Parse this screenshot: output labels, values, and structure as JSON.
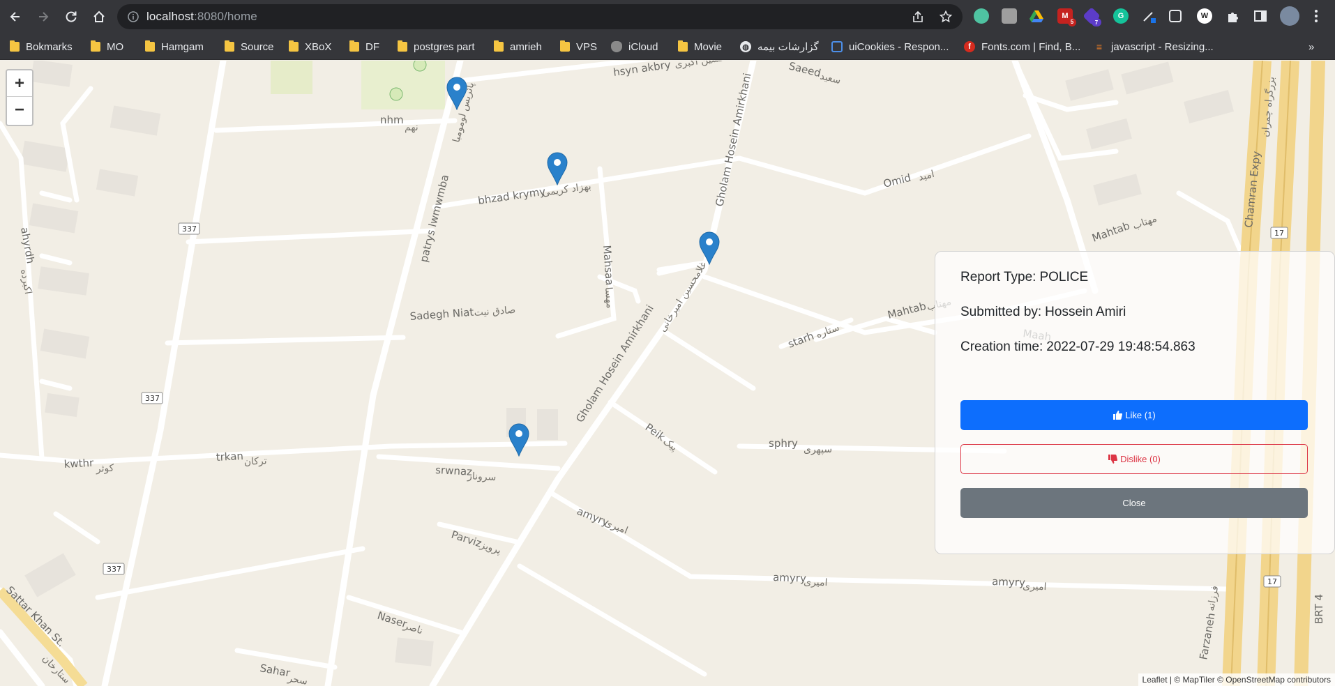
{
  "browser": {
    "url_host": "localhost",
    "url_path": ":8080/home"
  },
  "extensions": [
    {
      "icon": "lightbulb-extension-icon",
      "color": "#4fc3a1"
    },
    {
      "icon": "screenshot-extension-icon",
      "color": "#9e9e9e"
    },
    {
      "icon": "google-drive-icon",
      "color": "#34a853"
    },
    {
      "icon": "gmail-checker-icon",
      "color": "#c5221f",
      "badge": "5"
    },
    {
      "icon": "stack-extension-icon",
      "color": "#5c3cc8",
      "badge": "7"
    },
    {
      "icon": "grammarly-icon",
      "color": "#15c39a",
      "label": "G"
    },
    {
      "icon": "color-picker-icon",
      "color": "#3c3c3c"
    },
    {
      "icon": "cookie-extension-icon",
      "color": "#1f1f1f"
    },
    {
      "icon": "wordpress-icon",
      "color": "#1f1f1f",
      "label": "W"
    }
  ],
  "bookmarks": [
    {
      "label": "Bokmarks",
      "type": "folder"
    },
    {
      "label": "MO",
      "type": "folder"
    },
    {
      "label": "Hamgam",
      "type": "folder"
    },
    {
      "label": "Source",
      "type": "folder"
    },
    {
      "label": "XBoX",
      "type": "folder"
    },
    {
      "label": "DF",
      "type": "folder"
    },
    {
      "label": "postgres part",
      "type": "folder"
    },
    {
      "label": "amrieh",
      "type": "folder"
    },
    {
      "label": "VPS",
      "type": "folder"
    },
    {
      "label": "iCloud",
      "type": "apple"
    },
    {
      "label": "Movie",
      "type": "folder"
    },
    {
      "label": "گزارشات بیمه",
      "type": "globe"
    },
    {
      "label": "uiCookies - Respon...",
      "type": "uicookies"
    },
    {
      "label": "Fonts.com | Find, B...",
      "type": "fonts"
    },
    {
      "label": "javascript - Resizing...",
      "type": "stackoverflow"
    }
  ],
  "bookmarks_more": "»",
  "map": {
    "zoom_in": "+",
    "zoom_out": "−",
    "attribution": "Leaflet | © MapTiler © OpenStreetMap contributors",
    "labels": [
      "hsyn akbry",
      "حسین اکبری",
      "Saeed",
      "سعید",
      "nhm",
      "نهم",
      "bhzad krymy",
      "بهزاد کریمی",
      "Gholam Hosein Amirkhani",
      "Omid",
      "امید",
      "Mahtab",
      "مهتاب",
      "Chamran Expy",
      "بزرگراه چمران",
      "ahyrdh",
      "اکبرده",
      "patrys lwmwmba",
      "پاتریس لومومبا",
      "Mahsaa",
      "مهسا",
      "Sadegh Niat",
      "صادق نیت",
      "غلامحسین امیرخانی",
      "starh",
      "ستاره",
      "Maah",
      "Peik",
      "پیک",
      "sphry",
      "سپهری",
      "kwthr",
      "کوثر",
      "trkan",
      "ترکان",
      "srwnaz",
      "سروناز",
      "Parviz",
      "پرویز",
      "amyry",
      "امیری",
      "Naser",
      "ناصر",
      "Sahar",
      "سحر",
      "Sattar Khan St.",
      "ستارخان",
      "Farzaneh",
      "فرزانه",
      "BRT 4",
      "337",
      "17"
    ]
  },
  "popup": {
    "report_type_label": "Report Type:",
    "report_type_value": "POLICE",
    "submitted_by_label": "Submitted by:",
    "submitted_by_value": "Hossein Amiri",
    "creation_time_label": "Creation time:",
    "creation_time_value": "2022-07-29 19:48:54.863",
    "like_label": "Like (1)",
    "dislike_label": "Dislike (0)",
    "close_label": "Close"
  }
}
